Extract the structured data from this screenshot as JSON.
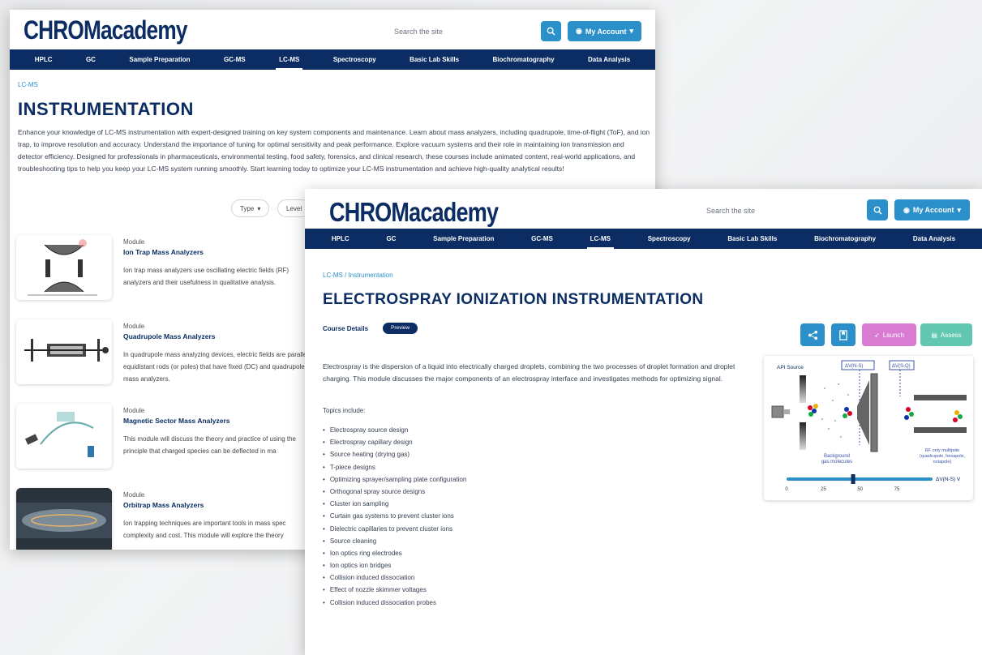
{
  "brand": "CHROMacademy",
  "header": {
    "search_placeholder": "Search the site",
    "search_icon": "search-icon",
    "account_label": "My Account",
    "account_icon": "user-circle-icon"
  },
  "nav": [
    "HPLC",
    "GC",
    "Sample Preparation",
    "GC-MS",
    "LC-MS",
    "Spectroscopy",
    "Basic Lab Skills",
    "Biochromatography",
    "Data Analysis"
  ],
  "active_nav": "LC-MS",
  "colors": {
    "navy": "#0b2d63",
    "blue": "#2b8fc9",
    "pink": "#d97bd0",
    "teal": "#62c7b0"
  },
  "back_page": {
    "breadcrumb": "LC-MS",
    "title": "INSTRUMENTATION",
    "description": "Enhance your knowledge of LC-MS instrumentation with expert-designed training on key system components and maintenance. Learn about mass analyzers, including quadrupole, time-of-flight (ToF), and ion trap, to improve resolution and accuracy. Understand the importance of tuning for optimal sensitivity and peak performance. Explore vacuum systems and their role in maintaining ion transmission and detector efficiency. Designed for professionals in pharmaceuticals, environmental testing, food safety, forensics, and clinical research, these courses include animated content, real-world applications, and troubleshooting tips to help you keep your LC-MS system running smoothly. Start learning today to optimize your LC-MS instrumentation and achieve high-quality analytical results!",
    "filters": [
      "Type",
      "Level"
    ],
    "modules": [
      {
        "kind": "Module",
        "title": "Ion Trap Mass Analyzers",
        "desc": "Ion trap mass analyzers use oscillating electric fields (RF) analyzers and their usefulness in qualitative analysis."
      },
      {
        "kind": "Module",
        "title": "Quadrupole Mass Analyzers",
        "desc": "In quadrupole mass analyzing devices, electric fields are parallel equidistant rods (or poles) that have fixed (DC) and quadrupole mass analyzers."
      },
      {
        "kind": "Module",
        "title": "Magnetic Sector Mass Analyzers",
        "desc": "This module will discuss the theory and practice of using the principle that charged species can be deflected in ma"
      },
      {
        "kind": "Module",
        "title": "Orbitrap Mass Analyzers",
        "desc": "Ion trapping techniques are important tools in mass spec complexity and cost. This module will explore the theory"
      }
    ]
  },
  "front_page": {
    "breadcrumb": "LC-MS / Instrumentation",
    "title": "ELECTROSPRAY IONIZATION INSTRUMENTATION",
    "course_details_label": "Course Details",
    "badge": "Preview",
    "share_icon": "share-icon",
    "bookmark_icon": "bookmark-icon",
    "launch_label": "Launch",
    "launch_icon": "rocket-icon",
    "assess_label": "Assess",
    "assess_icon": "clipboard-icon",
    "intro": "Electrospray is the dispersion of a liquid into electrically charged droplets, combining the two processes of droplet formation and droplet charging. This module discusses the major components of an electrospray interface and investigates methods for optimizing signal.",
    "topics_heading": "Topics include:",
    "topics": [
      "Electrospray source design",
      "Electrospray capillary design",
      "Source heating (drying gas)",
      "T-piece designs",
      "Optimizing sprayer/sampling plate configuration",
      "Orthogonal spray source designs",
      "Cluster ion sampling",
      "Curtain gas systems to prevent cluster ions",
      "Dielectric capillaries to prevent cluster ions",
      "Source cleaning",
      "Ion optics ring electrodes",
      "Ion optics ion bridges",
      "Collision induced dissociation",
      "Effect of nozzle skimmer voltages",
      "Collision induced dissociation probes"
    ],
    "figure": {
      "api_source": "API Source",
      "dv1": "ΔV(N-S)",
      "dv2": "ΔV(S-Q)",
      "background_label": "Background gas molecules",
      "rf_label": "RF only multipole (quadrupole, hexapole, octapole)",
      "slider_ticks": [
        "0",
        "25",
        "50",
        "75"
      ],
      "slider_label": "ΔV(N-S) V",
      "slider_value": 45
    }
  }
}
